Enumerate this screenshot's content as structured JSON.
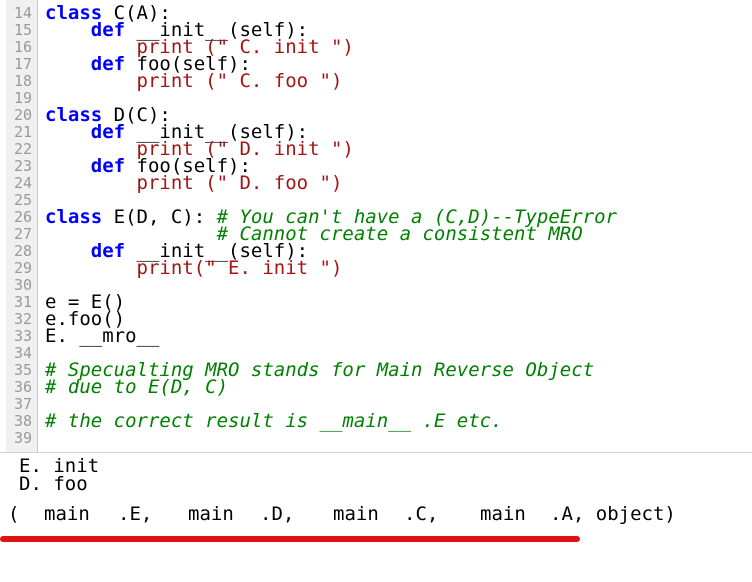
{
  "editor": {
    "line_numbers": [
      "14",
      "15",
      "16",
      "17",
      "18",
      "19",
      "20",
      "21",
      "22",
      "23",
      "24",
      "25",
      "26",
      "27",
      "28",
      "29",
      "30",
      "31",
      "32",
      "33",
      "34",
      "35",
      "36",
      "37",
      "38",
      "39"
    ],
    "lines": [
      {
        "kw": "class ",
        "name": "C(A):"
      },
      {
        "kw": "    def ",
        "name": "__init__(self):"
      },
      {
        "kw": "        ",
        "str": "print (\" C. init \")"
      },
      {
        "kw": "    def ",
        "name": "foo(self):"
      },
      {
        "kw": "        ",
        "str": "print (\" C. foo \")"
      },
      {
        "kw": "",
        "name": ""
      },
      {
        "kw": "class ",
        "name": "D(C):"
      },
      {
        "kw": "    def ",
        "name": "__init__(self):"
      },
      {
        "kw": "        ",
        "str": "print (\" D. init \")"
      },
      {
        "kw": "    def ",
        "name": "foo(self):"
      },
      {
        "kw": "        ",
        "str": "print (\" D. foo \")"
      },
      {
        "kw": "",
        "name": ""
      },
      {
        "kw": "class ",
        "name": "E(D, C): ",
        "cm": "# You can't have a (C,D)--TypeError"
      },
      {
        "kw": "               ",
        "cm": "# Cannot create a consistent MRO"
      },
      {
        "kw": "    def ",
        "name": "__init__(self):"
      },
      {
        "kw": "        ",
        "str": "print(\" E. init \")"
      },
      {
        "kw": "",
        "name": ""
      },
      {
        "kw": "",
        "name": "e = E()"
      },
      {
        "kw": "",
        "name": "e.foo()"
      },
      {
        "kw": "",
        "name": "E. __mro__"
      },
      {
        "kw": "",
        "name": ""
      },
      {
        "kw": "",
        "cm": "# Specualting MRO stands for Main Reverse Object"
      },
      {
        "kw": "",
        "cm": "# due to E(D, C)"
      },
      {
        "kw": "",
        "name": ""
      },
      {
        "kw": "",
        "cm": "# the correct result is __main__ .E etc."
      },
      {
        "kw": "",
        "name": ""
      }
    ]
  },
  "output": {
    "line1": "E. init",
    "line2": "D. foo",
    "mro_open": "(",
    "mro_items": [
      "main",
      ".E,",
      "main",
      ".D,",
      "main",
      ".C,",
      "main",
      ".A, object)"
    ]
  },
  "colors": {
    "keyword": "#0000ff",
    "string": "#a31515",
    "comment": "#008000",
    "underline": "#e21212"
  }
}
